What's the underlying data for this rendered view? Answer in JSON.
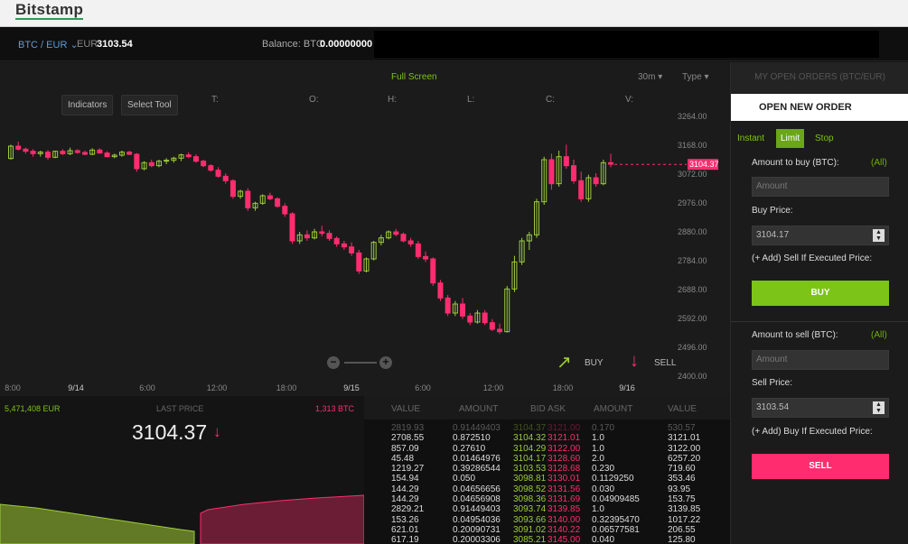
{
  "logo": "Bitstamp",
  "header": {
    "pair": "BTC / EUR",
    "currency_label": "EUR",
    "price": "3103.54",
    "balance_label": "Balance: BTC",
    "balance_value": "0.00000000"
  },
  "chart_toolbar": {
    "full_screen": "Full Screen",
    "interval": "30m",
    "type": "Type",
    "indicators": "Indicators",
    "select_tool": "Select Tool"
  },
  "ohlc_labels": [
    "T:",
    "O:",
    "H:",
    "L:",
    "C:",
    "V:"
  ],
  "chart_data": {
    "type": "candlestick",
    "yticks": [
      "3264.00",
      "3168.00",
      "3072.00",
      "2976.00",
      "2880.00",
      "2784.00",
      "2688.00",
      "2592.00",
      "2496.00",
      "2400.00"
    ],
    "xticks": [
      "8:00",
      "9/14",
      "6:00",
      "12:00",
      "18:00",
      "9/15",
      "6:00",
      "12:00",
      "18:00",
      "9/16"
    ],
    "ylim": [
      2400,
      3264
    ],
    "current_price": "3104.37",
    "candles": [
      [
        3124,
        3170,
        3120,
        3165
      ],
      [
        3165,
        3180,
        3150,
        3155
      ],
      [
        3155,
        3160,
        3140,
        3148
      ],
      [
        3148,
        3155,
        3130,
        3140
      ],
      [
        3140,
        3150,
        3130,
        3145
      ],
      [
        3145,
        3152,
        3120,
        3128
      ],
      [
        3128,
        3150,
        3125,
        3148
      ],
      [
        3148,
        3155,
        3135,
        3140
      ],
      [
        3140,
        3160,
        3135,
        3150
      ],
      [
        3150,
        3155,
        3140,
        3144
      ],
      [
        3144,
        3150,
        3135,
        3138
      ],
      [
        3138,
        3158,
        3135,
        3152
      ],
      [
        3152,
        3158,
        3140,
        3142
      ],
      [
        3142,
        3148,
        3128,
        3130
      ],
      [
        3130,
        3140,
        3125,
        3135
      ],
      [
        3135,
        3150,
        3130,
        3145
      ],
      [
        3145,
        3150,
        3135,
        3138
      ],
      [
        3138,
        3142,
        3080,
        3090
      ],
      [
        3090,
        3115,
        3085,
        3110
      ],
      [
        3110,
        3120,
        3095,
        3100
      ],
      [
        3100,
        3120,
        3095,
        3115
      ],
      [
        3115,
        3125,
        3105,
        3118
      ],
      [
        3118,
        3130,
        3110,
        3125
      ],
      [
        3125,
        3140,
        3115,
        3136
      ],
      [
        3136,
        3145,
        3125,
        3130
      ],
      [
        3130,
        3138,
        3110,
        3115
      ],
      [
        3115,
        3120,
        3095,
        3100
      ],
      [
        3100,
        3105,
        3080,
        3085
      ],
      [
        3085,
        3095,
        3060,
        3065
      ],
      [
        3065,
        3075,
        3040,
        3050
      ],
      [
        3050,
        3055,
        2990,
        2998
      ],
      [
        2998,
        3020,
        2990,
        3015
      ],
      [
        3015,
        3025,
        2950,
        2960
      ],
      [
        2960,
        2980,
        2950,
        2975
      ],
      [
        2975,
        3005,
        2970,
        3000
      ],
      [
        3000,
        3010,
        2985,
        2990
      ],
      [
        2990,
        2995,
        2960,
        2965
      ],
      [
        2965,
        2975,
        2930,
        2940
      ],
      [
        2940,
        2945,
        2840,
        2850
      ],
      [
        2850,
        2880,
        2840,
        2870
      ],
      [
        2870,
        2885,
        2850,
        2860
      ],
      [
        2860,
        2890,
        2855,
        2880
      ],
      [
        2880,
        2900,
        2865,
        2875
      ],
      [
        2875,
        2885,
        2850,
        2858
      ],
      [
        2858,
        2865,
        2830,
        2840
      ],
      [
        2840,
        2850,
        2820,
        2830
      ],
      [
        2830,
        2845,
        2800,
        2810
      ],
      [
        2810,
        2820,
        2740,
        2750
      ],
      [
        2750,
        2795,
        2745,
        2790
      ],
      [
        2790,
        2850,
        2785,
        2845
      ],
      [
        2845,
        2870,
        2835,
        2860
      ],
      [
        2860,
        2885,
        2855,
        2880
      ],
      [
        2880,
        2890,
        2865,
        2872
      ],
      [
        2872,
        2878,
        2845,
        2850
      ],
      [
        2850,
        2860,
        2830,
        2840
      ],
      [
        2840,
        2850,
        2790,
        2798
      ],
      [
        2798,
        2815,
        2780,
        2790
      ],
      [
        2790,
        2795,
        2700,
        2710
      ],
      [
        2710,
        2720,
        2650,
        2660
      ],
      [
        2660,
        2670,
        2600,
        2610
      ],
      [
        2610,
        2650,
        2600,
        2640
      ],
      [
        2640,
        2660,
        2590,
        2600
      ],
      [
        2600,
        2610,
        2570,
        2580
      ],
      [
        2580,
        2620,
        2575,
        2610
      ],
      [
        2610,
        2620,
        2570,
        2578
      ],
      [
        2578,
        2590,
        2550,
        2556
      ],
      [
        2556,
        2575,
        2540,
        2548
      ],
      [
        2548,
        2700,
        2545,
        2690
      ],
      [
        2690,
        2800,
        2680,
        2780
      ],
      [
        2780,
        2860,
        2770,
        2850
      ],
      [
        2850,
        2880,
        2820,
        2870
      ],
      [
        2870,
        2990,
        2860,
        2980
      ],
      [
        2980,
        3130,
        2970,
        3120
      ],
      [
        3120,
        3140,
        3020,
        3040
      ],
      [
        3040,
        3150,
        3030,
        3130
      ],
      [
        3130,
        3170,
        3090,
        3100
      ],
      [
        3100,
        3120,
        3040,
        3050
      ],
      [
        3050,
        3080,
        2980,
        2990
      ],
      [
        2990,
        3070,
        2980,
        3060
      ],
      [
        3060,
        3075,
        3030,
        3040
      ],
      [
        3040,
        3120,
        3035,
        3110
      ],
      [
        3110,
        3140,
        3095,
        3105
      ]
    ]
  },
  "chart_actions": {
    "buy": "BUY",
    "sell": "SELL"
  },
  "market": {
    "volume_eur": "5,471,408 EUR",
    "last_price_label": "LAST PRICE",
    "volume_btc": "1,313 BTC",
    "last_price": "3104.37"
  },
  "orderbook": {
    "headers": [
      "VALUE",
      "AMOUNT",
      "BID",
      "ASK",
      "AMOUNT",
      "VALUE"
    ],
    "rows": [
      [
        "2819.93",
        "0.91449403",
        "3104.37",
        "3121.00",
        "0.170",
        "530.57"
      ],
      [
        "2708.55",
        "0.872510",
        "3104.32",
        "3121.01",
        "1.0",
        "3121.01"
      ],
      [
        "857.09",
        "0.27610",
        "3104.29",
        "3122.00",
        "1.0",
        "3122.00"
      ],
      [
        "45.48",
        "0.01464976",
        "3104.17",
        "3128.60",
        "2.0",
        "6257.20"
      ],
      [
        "1219.27",
        "0.39286544",
        "3103.53",
        "3128.68",
        "0.230",
        "719.60"
      ],
      [
        "154.94",
        "0.050",
        "3098.81",
        "3130.01",
        "0.1129250",
        "353.46"
      ],
      [
        "144.29",
        "0.04656656",
        "3098.52",
        "3131.56",
        "0.030",
        "93.95"
      ],
      [
        "144.29",
        "0.04656908",
        "3098.36",
        "3131.69",
        "0.04909485",
        "153.75"
      ],
      [
        "2829.21",
        "0.91449403",
        "3093.74",
        "3139.85",
        "1.0",
        "3139.85"
      ],
      [
        "153.26",
        "0.04954036",
        "3093.66",
        "3140.00",
        "0.32395470",
        "1017.22"
      ],
      [
        "621.01",
        "0.20090731",
        "3091.02",
        "3140.22",
        "0.06577581",
        "206.55"
      ],
      [
        "617.19",
        "0.20003306",
        "3085.21",
        "3145.00",
        "0.040",
        "125.80"
      ]
    ]
  },
  "order_panel": {
    "my_orders_tab": "MY OPEN ORDERS (BTC/EUR)",
    "new_order_tab": "OPEN NEW ORDER",
    "types": [
      "Instant",
      "Limit",
      "Stop"
    ],
    "buy_amount_label": "Amount to buy (BTC):",
    "all_label": "(All)",
    "amount_placeholder": "Amount",
    "buy_price_label": "Buy Price:",
    "buy_price": "3104.17",
    "sell_if_executed": "(+ Add) Sell If Executed Price:",
    "buy_button": "BUY",
    "sell_amount_label": "Amount to sell (BTC):",
    "sell_price_label": "Sell Price:",
    "sell_price": "3103.54",
    "buy_if_executed": "(+ Add) Buy If Executed Price:",
    "sell_button": "SELL"
  },
  "colors": {
    "up": "#9ccd3c",
    "down": "#ff2d6f",
    "buy": "#7cc417",
    "sell": "#ff2d6f",
    "pair": "#5d9bd6"
  }
}
